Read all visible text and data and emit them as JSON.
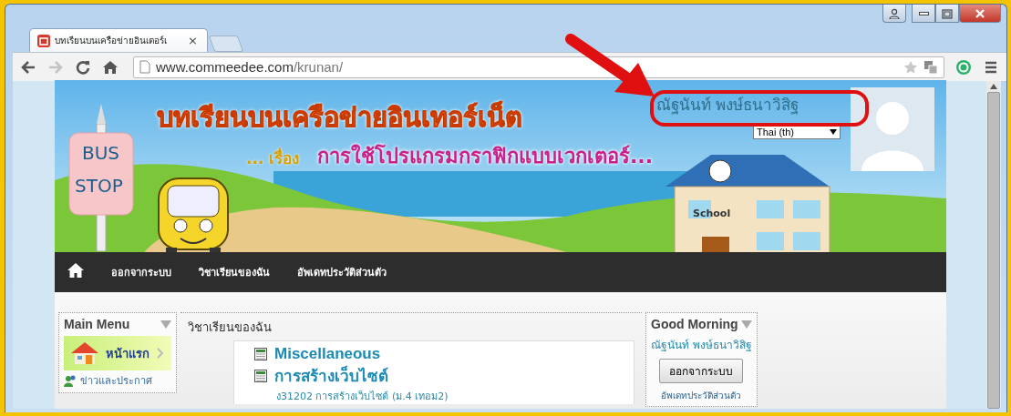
{
  "browser": {
    "tab": {
      "title": "บทเรียนบนเครือข่ายอินเตอร์เ",
      "close": "×"
    },
    "address": {
      "domain": "www.commeedee.com",
      "path": "/krunan/"
    }
  },
  "banner": {
    "title": "บทเรียนบนเครือข่ายอินเทอร์เน็ต",
    "subtitle_prefix": "... เรื่อง",
    "subtitle": "การใช้โปรแกรมกราฟิกแบบเวกเตอร์...",
    "bus_stop": [
      "BUS",
      "STOP"
    ],
    "school_sign": "School",
    "user_name": "ณัฐนันท์ พงษ์ธนาวิสิฐ",
    "language": "Thai (th)"
  },
  "nav": {
    "items": [
      "ออกจากระบบ",
      "วิชาเรียนของฉัน",
      "อัพเดทประวัติส่วนตัว"
    ]
  },
  "main_menu": {
    "title": "Main Menu",
    "items": [
      {
        "label": "หน้าแรก",
        "kind": "featured"
      },
      {
        "label": "ข่าวและประกาศ",
        "kind": "link"
      }
    ]
  },
  "courses": {
    "title": "วิชาเรียนของฉัน",
    "items": [
      {
        "name": "Miscellaneous"
      },
      {
        "name": "การสร้างเว็บไซต์",
        "summary": "ง31202 การสร้างเว็บไซต์ (ม.4 เทอม2)"
      }
    ]
  },
  "greeting": {
    "title": "Good Morning",
    "user_name": "ณัฐนันท์ พงษ์ธนาวิสิฐ",
    "logout_button": "ออกจากระบบ",
    "profile_link": "อัพเดทประวัติส่วนตัว"
  }
}
